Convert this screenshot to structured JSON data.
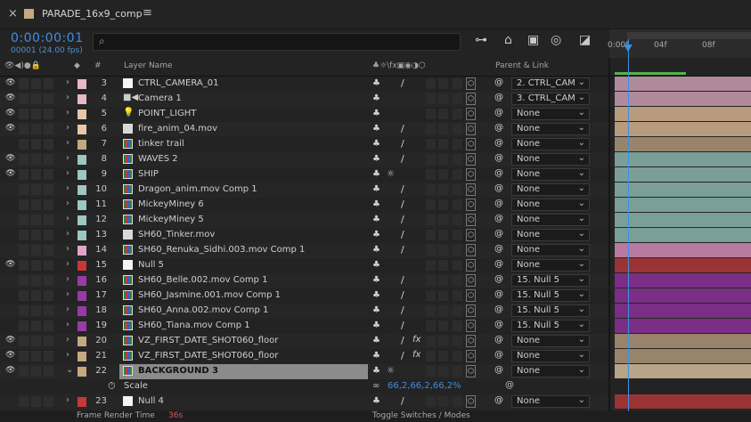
{
  "tab": {
    "title": "PARADE_16x9_comp",
    "close": "×",
    "menu": "≡",
    "swatch_color": "#c4a880"
  },
  "time": {
    "timecode": "0:00:00:01",
    "fps_text": "00001 (24.00 fps)",
    "search_placeholder": ""
  },
  "ruler": {
    "labels": [
      "0:00f",
      "04f",
      "08f"
    ]
  },
  "headers": {
    "layer_name": "Layer Name",
    "parent_link": "Parent & Link",
    "hash": "#"
  },
  "layers": [
    {
      "num": "3",
      "name": "CTRL_CAMERA_01",
      "label_color": "#e6b8c8",
      "type": "solid",
      "eye": true,
      "parent": "2. CTRL_CAM",
      "timeline_color": "#b08a9a",
      "slash": true,
      "fx": false,
      "q2": false
    },
    {
      "num": "4",
      "name": "Camera 1",
      "label_color": "#e6b8c8",
      "type": "camera",
      "eye": true,
      "parent": "3. CTRL_CAM",
      "timeline_color": "#b08a9a",
      "slash": false,
      "fx": false,
      "q2": false
    },
    {
      "num": "5",
      "name": "POINT_LIGHT",
      "label_color": "#e8c6a8",
      "type": "light",
      "eye": true,
      "parent": "None",
      "timeline_color": "#b89a7c",
      "slash": false,
      "fx": false,
      "q2": false
    },
    {
      "num": "6",
      "name": "fire_anim_04.mov",
      "label_color": "#e8c6a8",
      "type": "footage",
      "eye": true,
      "parent": "None",
      "timeline_color": "#b89a7c",
      "slash": true,
      "fx": false,
      "q2": false
    },
    {
      "num": "7",
      "name": "tinker trail",
      "label_color": "#c4a880",
      "type": "comp",
      "eye": false,
      "parent": "None",
      "timeline_color": "#98846a",
      "slash": true,
      "fx": false,
      "q2": false
    },
    {
      "num": "8",
      "name": "WAVES 2",
      "label_color": "#9cc8c0",
      "type": "comp",
      "eye": true,
      "parent": "None",
      "timeline_color": "#7a9e98",
      "slash": true,
      "fx": false,
      "q2": false
    },
    {
      "num": "9",
      "name": "SHIP",
      "label_color": "#9cc8c0",
      "type": "comp",
      "eye": true,
      "parent": "None",
      "timeline_color": "#7a9e98",
      "slash": false,
      "fx": false,
      "q2": true
    },
    {
      "num": "10",
      "name": "Dragon_anim.mov Comp 1",
      "label_color": "#9cc8c0",
      "type": "comp",
      "eye": false,
      "parent": "None",
      "timeline_color": "#7a9e98",
      "slash": true,
      "fx": false,
      "q2": false
    },
    {
      "num": "11",
      "name": "MickeyMiney 6",
      "label_color": "#9cc8c0",
      "type": "comp",
      "eye": false,
      "parent": "None",
      "timeline_color": "#7a9e98",
      "slash": true,
      "fx": false,
      "q2": false
    },
    {
      "num": "12",
      "name": "MickeyMiney 5",
      "label_color": "#9cc8c0",
      "type": "comp",
      "eye": false,
      "parent": "None",
      "timeline_color": "#7a9e98",
      "slash": true,
      "fx": false,
      "q2": false
    },
    {
      "num": "13",
      "name": "SH60_Tinker.mov",
      "label_color": "#9cc8c0",
      "type": "footage",
      "eye": false,
      "parent": "None",
      "timeline_color": "#7a9e98",
      "slash": true,
      "fx": false,
      "q2": false
    },
    {
      "num": "14",
      "name": "SH60_Renuka_Sidhi.003.mov Comp 1",
      "label_color": "#e2a4c8",
      "type": "comp",
      "eye": false,
      "parent": "None",
      "timeline_color": "#b87aa0",
      "slash": true,
      "fx": false,
      "q2": false
    },
    {
      "num": "15",
      "name": "Null 5",
      "label_color": "#c83838",
      "type": "solid",
      "eye": true,
      "parent": "None",
      "timeline_color": "#9a3434",
      "slash": false,
      "fx": false,
      "q2": false
    },
    {
      "num": "16",
      "name": "SH60_Belle.002.mov Comp 1",
      "label_color": "#9a3aa8",
      "type": "comp",
      "eye": false,
      "parent": "15. Null 5",
      "timeline_color": "#7a2e86",
      "slash": true,
      "fx": false,
      "q2": false
    },
    {
      "num": "17",
      "name": "SH60_Jasmine.001.mov Comp 1",
      "label_color": "#9a3aa8",
      "type": "comp",
      "eye": false,
      "parent": "15. Null 5",
      "timeline_color": "#7a2e86",
      "slash": true,
      "fx": false,
      "q2": false
    },
    {
      "num": "18",
      "name": "SH60_Anna.002.mov Comp 1",
      "label_color": "#9a3aa8",
      "type": "comp",
      "eye": false,
      "parent": "15. Null 5",
      "timeline_color": "#7a2e86",
      "slash": true,
      "fx": false,
      "q2": false
    },
    {
      "num": "19",
      "name": "SH60_Tiana.mov Comp 1",
      "label_color": "#9a3aa8",
      "type": "comp",
      "eye": false,
      "parent": "15. Null 5",
      "timeline_color": "#7a2e86",
      "slash": true,
      "fx": false,
      "q2": false
    },
    {
      "num": "20",
      "name": "VZ_FIRST_DATE_SHOT060_floor",
      "label_color": "#c4a880",
      "type": "comp",
      "eye": true,
      "parent": "None",
      "timeline_color": "#98846a",
      "slash": true,
      "fx": true,
      "q2": false
    },
    {
      "num": "21",
      "name": "VZ_FIRST_DATE_SHOT060_floor",
      "label_color": "#c4a880",
      "type": "comp",
      "eye": true,
      "parent": "None",
      "timeline_color": "#98846a",
      "slash": true,
      "fx": true,
      "q2": false
    },
    {
      "num": "22",
      "name": "BACKGROUND 3",
      "label_color": "#c4a880",
      "type": "comp",
      "eye": true,
      "parent": "None",
      "timeline_color": "#b8a486",
      "slash": false,
      "fx": false,
      "q2": true,
      "selected": true,
      "expanded": true
    }
  ],
  "scale_property": {
    "name": "Scale",
    "value": "66,2,66,2,66,2%"
  },
  "last_layer": {
    "num": "23",
    "name": "Null 4",
    "label_color": "#c83838",
    "parent": "None",
    "timeline_color": "#9a3434"
  },
  "bottom": {
    "label": "Frame Render Time",
    "value": "36s",
    "toggle": "Toggle Switches / Modes"
  }
}
